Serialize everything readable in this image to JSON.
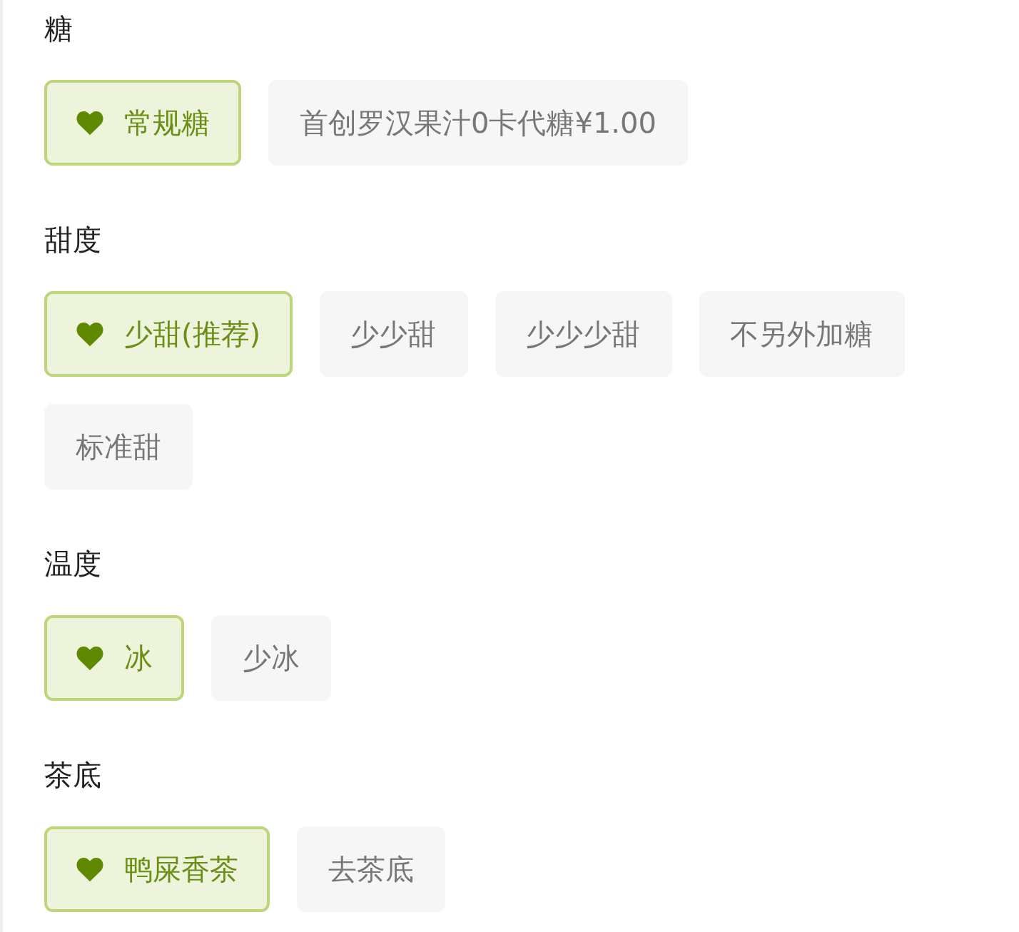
{
  "sections": [
    {
      "title": "糖",
      "options": [
        {
          "label": "常规糖",
          "selected": true
        },
        {
          "label": "首创罗汉果汁0卡代糖¥1.00",
          "selected": false
        }
      ]
    },
    {
      "title": "甜度",
      "options": [
        {
          "label": "少甜(推荐)",
          "selected": true
        },
        {
          "label": "少少甜",
          "selected": false
        },
        {
          "label": "少少少甜",
          "selected": false
        },
        {
          "label": "不另外加糖",
          "selected": false
        },
        {
          "label": "标准甜",
          "selected": false
        }
      ]
    },
    {
      "title": "温度",
      "options": [
        {
          "label": "冰",
          "selected": true
        },
        {
          "label": "少冰",
          "selected": false
        }
      ]
    },
    {
      "title": "茶底",
      "options": [
        {
          "label": "鸭屎香茶",
          "selected": true
        },
        {
          "label": "去茶底",
          "selected": false
        }
      ]
    }
  ]
}
